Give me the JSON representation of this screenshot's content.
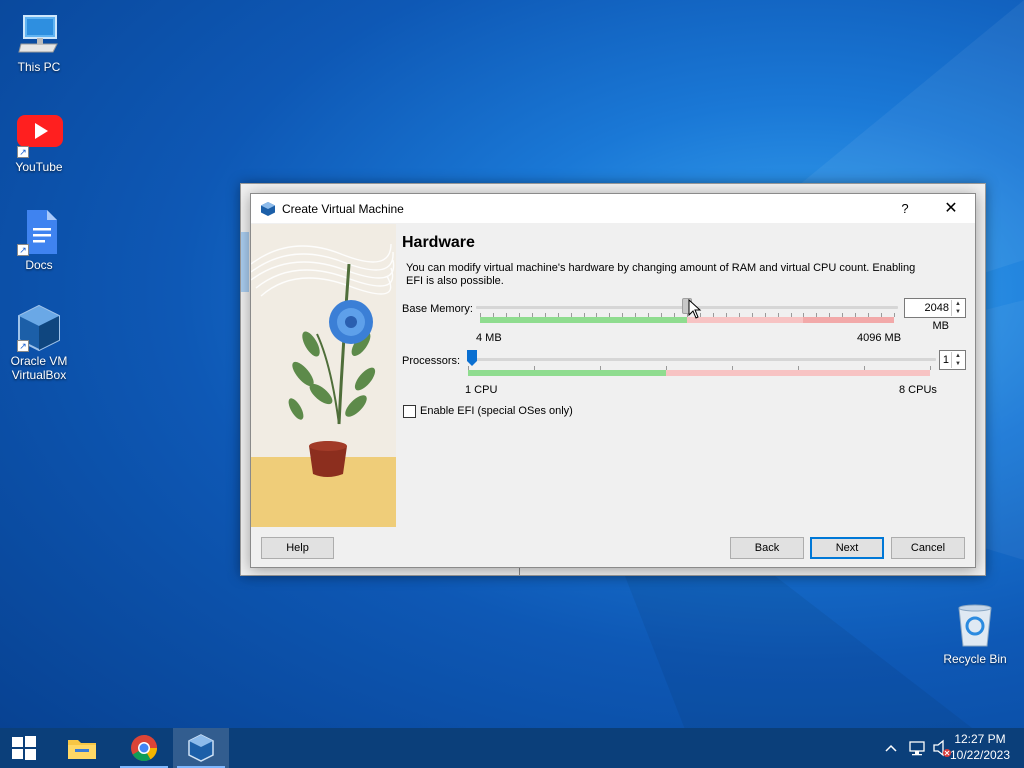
{
  "desktop": {
    "icons": [
      {
        "label": "This PC"
      },
      {
        "label": "YouTube"
      },
      {
        "label": "Docs"
      },
      {
        "label": "Oracle VM VirtualBox"
      },
      {
        "label": "Recycle Bin"
      }
    ]
  },
  "dialog": {
    "title": "Create Virtual Machine",
    "help_glyph": "?",
    "close_glyph": "✕",
    "heading": "Hardware",
    "description": "You can modify virtual machine's hardware by changing amount of RAM and virtual CPU count. Enabling EFI is also possible.",
    "memory": {
      "label": "Base Memory:",
      "value": "2048 MB",
      "value_mb": 2048,
      "min_label": "4 MB",
      "max_label": "4096 MB",
      "min_mb": 4,
      "max_mb": 4096
    },
    "processors": {
      "label": "Processors:",
      "value": "1",
      "value_count": 1,
      "min_label": "1 CPU",
      "max_label": "8 CPUs",
      "min_count": 1,
      "max_count": 8
    },
    "efi": {
      "label": "Enable EFI (special OSes only)",
      "checked": false
    },
    "buttons": {
      "help": "Help",
      "back": "Back",
      "next": "Next",
      "cancel": "Cancel"
    }
  },
  "taskbar": {
    "items": [
      "start-button",
      "file-explorer-icon",
      "chrome-icon",
      "virtualbox-icon"
    ],
    "clock_time": "12:27 PM",
    "clock_date": "10/22/2023"
  },
  "colors": {
    "accent": "#0078d7",
    "scale_green": "#8fdc8f",
    "scale_red": "#f2a9a9",
    "taskbar": "#0b3f7a"
  }
}
